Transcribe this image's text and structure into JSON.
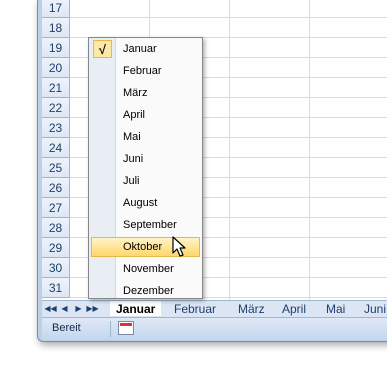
{
  "sheet": {
    "row_numbers": [
      "17",
      "18",
      "19",
      "20",
      "21",
      "22",
      "23",
      "24",
      "25",
      "26",
      "27",
      "28",
      "29",
      "30",
      "31"
    ]
  },
  "tabs": {
    "nav": [
      "◀◀",
      "◀",
      "▶",
      "▶▶"
    ],
    "items": [
      "Januar",
      "Februar",
      "März",
      "April",
      "Mai",
      "Juni"
    ],
    "active": "Januar"
  },
  "status": {
    "text": "Bereit",
    "icon": "macro-record-icon"
  },
  "menu": {
    "checked_mark": "√",
    "items": [
      "Januar",
      "Februar",
      "März",
      "April",
      "Mai",
      "Juni",
      "Juli",
      "August",
      "September",
      "Oktober",
      "November",
      "Dezember"
    ],
    "checked": "Januar",
    "highlighted": "Oktober"
  }
}
